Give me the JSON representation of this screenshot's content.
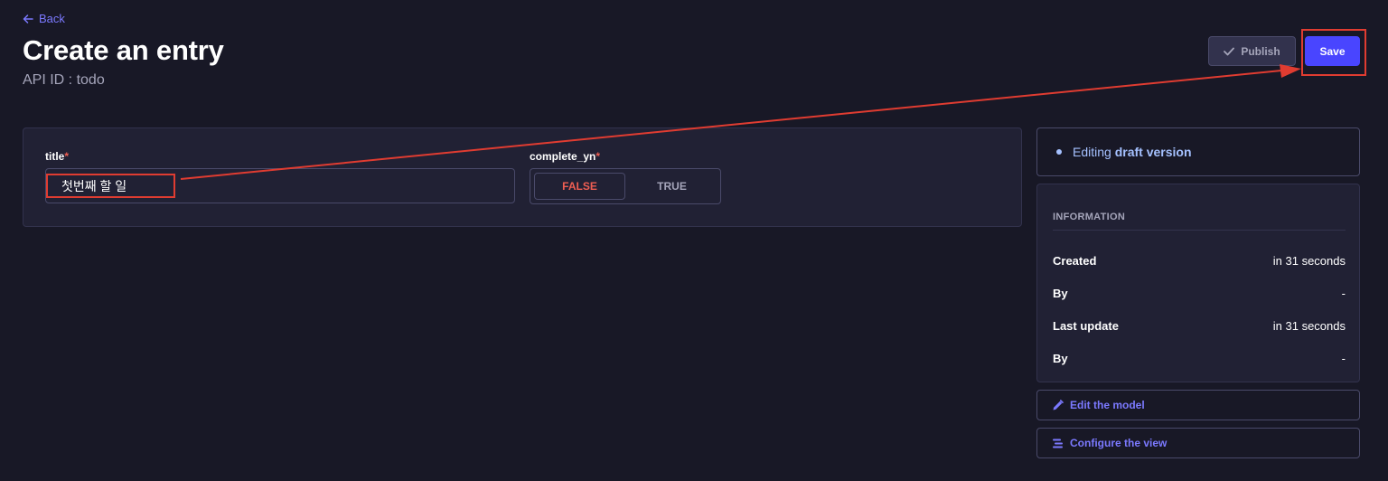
{
  "header": {
    "back_label": "Back",
    "title": "Create an entry",
    "api_id": "API ID : todo",
    "publish_label": "Publish",
    "save_label": "Save"
  },
  "form": {
    "title_field": {
      "label": "title",
      "required_mark": "*",
      "value": "첫번째 할 일"
    },
    "complete_field": {
      "label": "complete_yn",
      "required_mark": "*",
      "options": [
        "FALSE",
        "TRUE"
      ],
      "selected": "FALSE"
    }
  },
  "sidebar": {
    "status_prefix": "Editing",
    "status_version": "draft version",
    "information": {
      "heading": "INFORMATION",
      "rows": [
        {
          "key": "Created",
          "value": "in 31 seconds"
        },
        {
          "key": "By",
          "value": "-"
        },
        {
          "key": "Last update",
          "value": "in 31 seconds"
        },
        {
          "key": "By",
          "value": "-"
        }
      ]
    },
    "edit_model_label": "Edit the model",
    "configure_view_label": "Configure the view"
  },
  "icons": {
    "back": "arrow-left-icon",
    "publish": "check-icon",
    "edit_model": "pencil-icon",
    "configure_view": "list-icon"
  },
  "colors": {
    "background": "#181826",
    "card": "#212134",
    "primary": "#4945ff",
    "link": "#7b79ff",
    "danger": "#ee5e52",
    "status": "#a5c1ff",
    "annotation": "#e03c31"
  }
}
